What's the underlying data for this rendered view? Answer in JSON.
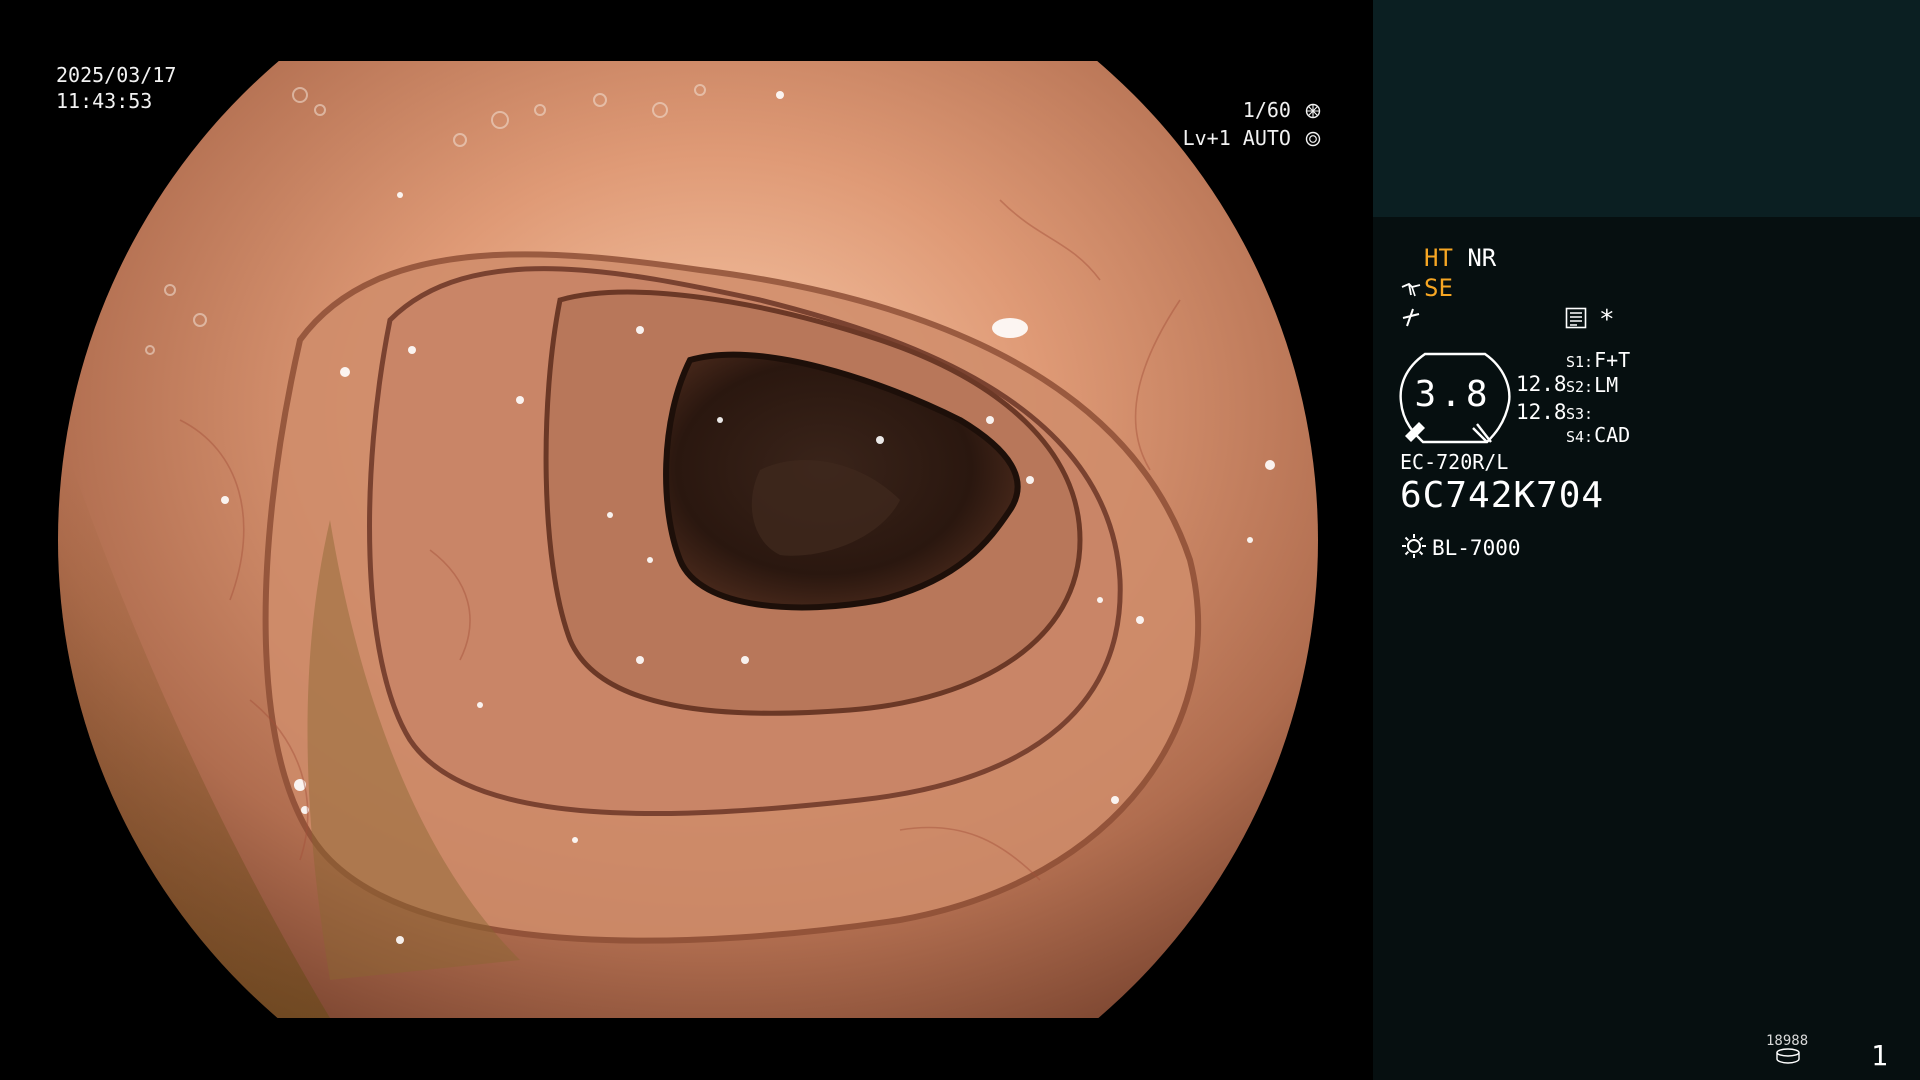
{
  "overlay": {
    "date": "2025/03/17",
    "time": "11:43:53",
    "shutter": "1/60",
    "level": "Lv+1 AUTO"
  },
  "panel": {
    "ht": "HT",
    "nr": "NR",
    "se": "SE",
    "gauge_value": "3.8",
    "gauge_readings": [
      "12.8",
      "12.8"
    ],
    "switches": [
      {
        "key": "S1:",
        "value": "F+T"
      },
      {
        "key": "S2:",
        "value": "LM"
      },
      {
        "key": "S3:",
        "value": ""
      },
      {
        "key": "S4:",
        "value": "CAD"
      }
    ],
    "scope_model": "EC-720R/L",
    "scope_serial": "6C742K704",
    "light_source": "BL-7000",
    "counter_label": "18988",
    "image_count": "1",
    "asterisk": "*"
  },
  "colors": {
    "accent_orange": "#f6a623",
    "panel_bg": "#060f10",
    "thumb_bg": "#0b1f22",
    "mucosa": "#c07a5a"
  },
  "icons": {
    "shutter": "aperture-icon",
    "auto": "iris-icon",
    "se": "wave-hand-icon",
    "sym": "slash-icon",
    "memo": "memo-list-icon",
    "lamp": "sun-icon",
    "disk": "disk-icon"
  }
}
